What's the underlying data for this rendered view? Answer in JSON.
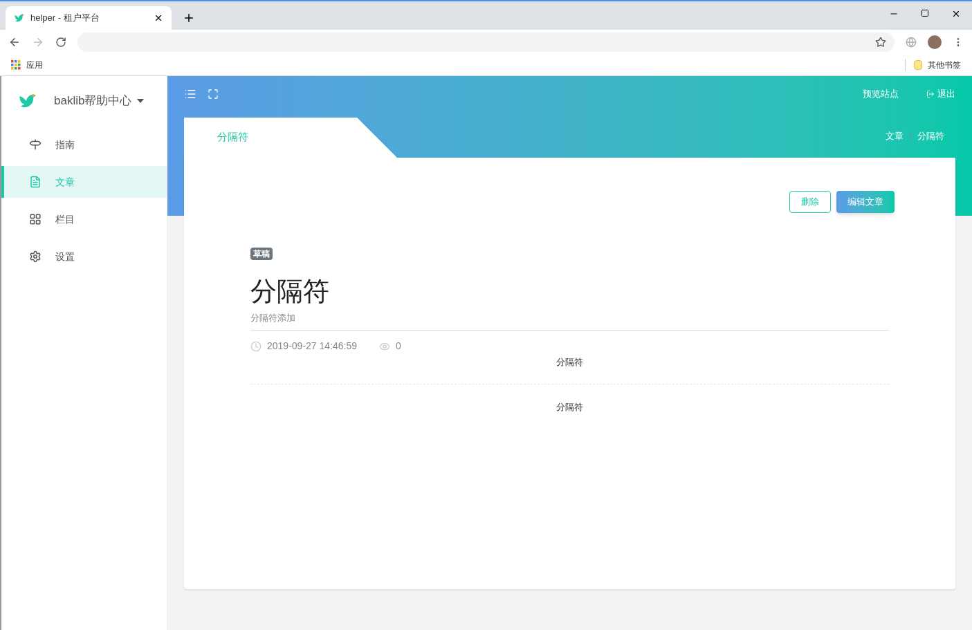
{
  "browser": {
    "tab_title": "helper - 租户平台",
    "bookmarks": [
      {
        "kind": "apps",
        "label": "应用"
      }
    ],
    "other_bookmarks": "其他书签"
  },
  "sidebar": {
    "site_name": "baklib帮助中心",
    "items": [
      {
        "kind": "guide",
        "label": "指南",
        "selected": false
      },
      {
        "kind": "article",
        "label": "文章",
        "selected": true
      },
      {
        "kind": "column",
        "label": "栏目",
        "selected": false
      },
      {
        "kind": "settings",
        "label": "设置",
        "selected": false
      }
    ]
  },
  "header": {
    "links": [
      {
        "kind": "preview",
        "label": "预览站点"
      },
      {
        "kind": "logout",
        "label": "退出"
      }
    ]
  },
  "page_tab": "分隔符",
  "breadcrumb": [
    "文章",
    "分隔符"
  ],
  "breadcrumb_separator": "/",
  "actions": [
    {
      "kind": "outline",
      "label": "删除"
    },
    {
      "kind": "primary",
      "label": "编辑文章"
    }
  ],
  "article": {
    "status": "草稿",
    "title": "分隔符",
    "subtitle": "分隔符添加",
    "date": "2019-09-27 14:46:59",
    "views": "0",
    "blocks": [
      {
        "kind": "text",
        "text": "分隔符"
      },
      {
        "kind": "divider"
      },
      {
        "kind": "text",
        "text": "分隔符"
      }
    ]
  }
}
